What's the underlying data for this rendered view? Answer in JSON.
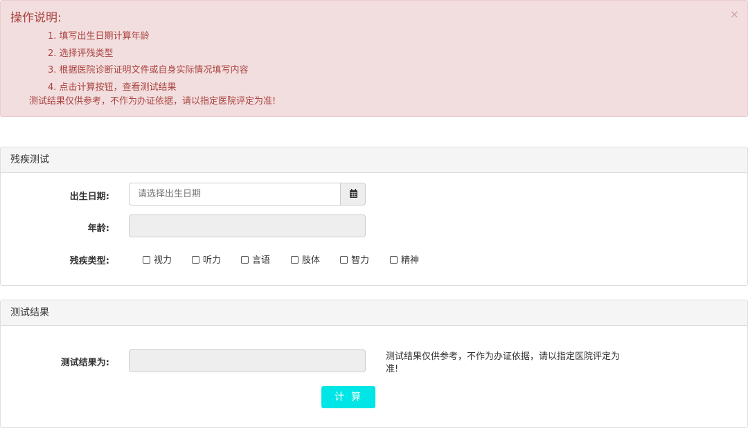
{
  "alert": {
    "title": "操作说明:",
    "close": "×",
    "steps": [
      "1. 填写出生日期计算年龄",
      "2. 选择评残类型",
      "3. 根据医院诊断证明文件或自身实际情况填写内容",
      "4. 点击计算按钮，查看测试结果"
    ],
    "note": "测试结果仅供参考，不作为办证依据，请以指定医院评定为准!"
  },
  "test_panel": {
    "heading": "残疾测试",
    "birth_label": "出生日期:",
    "birth_placeholder": "请选择出生日期",
    "birth_value": "",
    "calendar_icon": "calendar-icon",
    "age_label": "年龄:",
    "age_value": "",
    "type_label": "残疾类型:",
    "types": [
      "视力",
      "听力",
      "言语",
      "肢体",
      "智力",
      "精神"
    ]
  },
  "result_panel": {
    "heading": "测试结果",
    "result_label": "测试结果为:",
    "result_value": "",
    "note": "测试结果仅供参考，不作为办证依据，请以指定医院评定为准!",
    "calc_button": "计算"
  },
  "colors": {
    "alert_bg": "#f2dede",
    "alert_text": "#a94442",
    "button_bg": "#00e5e5"
  }
}
